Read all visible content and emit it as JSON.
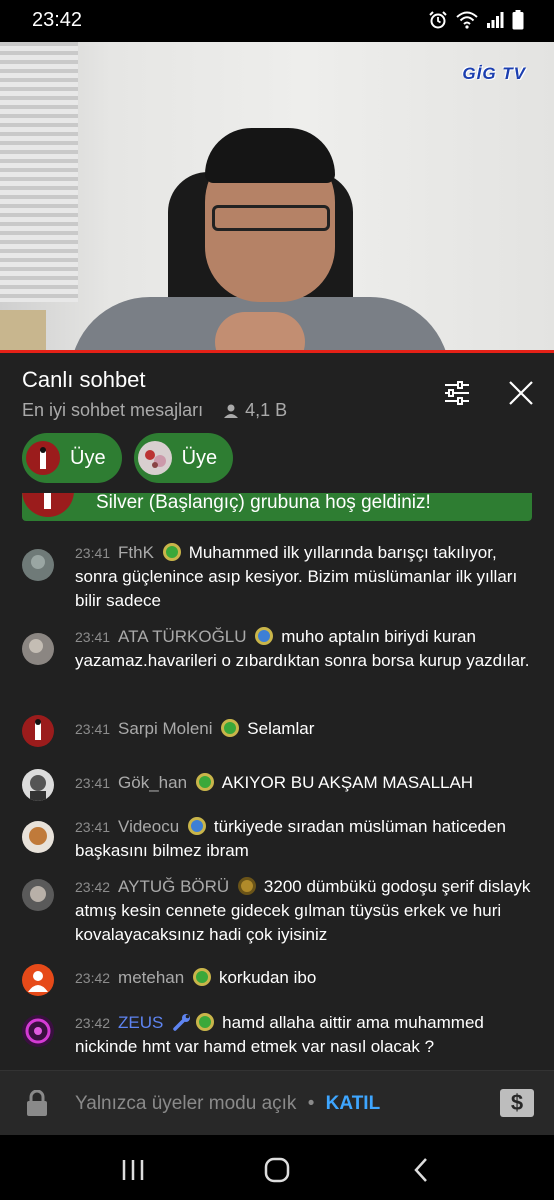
{
  "status_bar": {
    "time": "23:42"
  },
  "video": {
    "channel_logo": "GİG TV"
  },
  "header": {
    "title": "Canlı sohbet",
    "subtitle": "En iyi sohbet mesajları",
    "viewer_count": "4,1 B"
  },
  "chips": [
    {
      "label": "Üye"
    },
    {
      "label": "Üye"
    }
  ],
  "banner": {
    "text": "Silver (Başlangıç) grubuna hoş geldiniz!"
  },
  "messages": [
    {
      "time": "23:41",
      "author": "FthK",
      "text": "Muhammed ilk yıllarında barışçı takılıyor, sonra güçlenince asıp kesiyor. Bizim müslümanlar ilk yılları bilir sadece",
      "badge_color": "#3aa83a"
    },
    {
      "time": "23:41",
      "author": "ATA TÜRKOĞLU",
      "text": "muho aptalın biriydi kuran yazamaz.havarileri o zıbardıktan sonra borsa kurup yazdılar.",
      "badge_color": "#3d7fd6"
    },
    {
      "time": "23:41",
      "author": "Sarpi Moleni",
      "text": "Selamlar",
      "badge_color": "#3aa83a"
    },
    {
      "time": "23:41",
      "author": "Gök_han",
      "text": "AKIYOR BU AKŞAM MASALLAH",
      "badge_color": "#3aa83a"
    },
    {
      "time": "23:41",
      "author": "Videocu",
      "text": "türkiyede sıradan müslüman haticeden başkasını bilmez ibram",
      "badge_color": "#3d7fd6"
    },
    {
      "time": "23:42",
      "author": "AYTUĞ BÖRÜ",
      "text": "3200 dümbükü godoşu şerif dislayk atmış kesin cennete gidecek gılman tüysüs erkek ve huri kovalayacaksınız hadi çok iyisiniz",
      "badge_color": "#b08a2a"
    },
    {
      "time": "23:42",
      "author": "metehan",
      "text": "korkudan ibo",
      "badge_color": "#3aa83a"
    },
    {
      "time": "23:42",
      "author": "ZEUS",
      "text": "hamd allaha aittir ama muhammed nickinde hmt var hamd etmek var nasıl olacak ?",
      "badge_color": "#3aa83a"
    }
  ],
  "input": {
    "placeholder": "Yalnızca üyeler modu açık",
    "separator": "•",
    "join_label": "KATIL",
    "superchat_symbol": "$"
  },
  "colors": {
    "accent_red": "#e62117",
    "member_green": "#2e7d32",
    "link_blue": "#3ea6ff"
  }
}
